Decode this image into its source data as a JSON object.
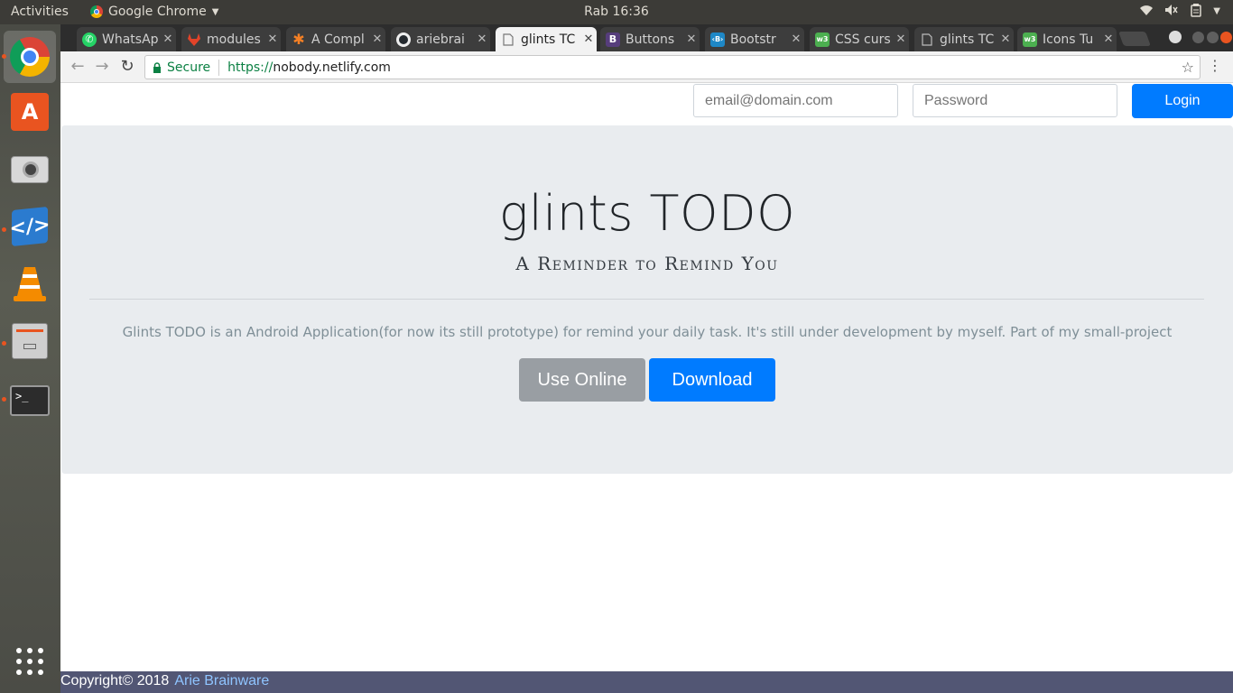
{
  "topbar": {
    "activities": "Activities",
    "app_name": "Google Chrome",
    "clock": "Rab 16:36"
  },
  "dock": {
    "items": [
      "chrome-icon",
      "software-center-icon",
      "camera-icon",
      "vscode-icon",
      "vlc-icon",
      "file-manager-icon",
      "terminal-icon",
      "show-apps-icon"
    ]
  },
  "tabs": [
    {
      "title": "WhatsAp",
      "icon": "whatsapp-icon",
      "color": "#25d366"
    },
    {
      "title": "modules",
      "icon": "gitlab-icon",
      "color": "#e24329"
    },
    {
      "title": "A Compl",
      "icon": "asterisk-icon",
      "color": "#f58025"
    },
    {
      "title": "ariebrai",
      "icon": "github-icon",
      "color": "#24292e"
    },
    {
      "title": "glints TC",
      "icon": "page-icon",
      "color": "#777777"
    },
    {
      "title": "Buttons",
      "icon": "bootstrap-icon",
      "color": "#563d7c"
    },
    {
      "title": "Bootstr",
      "icon": "bootstrap-code-icon",
      "color": "#1e88c7"
    },
    {
      "title": "CSS curs",
      "icon": "w3-icon",
      "color": "#4caf50"
    },
    {
      "title": "glints TC",
      "icon": "page-icon",
      "color": "#777777"
    },
    {
      "title": "Icons Tu",
      "icon": "w3-icon",
      "color": "#4caf50"
    }
  ],
  "omnibox": {
    "secure": "Secure",
    "protocol": "https://",
    "host": "nobody.netlify.com"
  },
  "login": {
    "email_placeholder": "email@domain.com",
    "password_placeholder": "Password",
    "button": "Login"
  },
  "hero": {
    "title": "glints TODO",
    "subtitle": "A Reminder to Remind You",
    "lead": "Glints TODO is an Android Application(for now its still prototype) for remind your daily task. It's still under development by myself. Part of my small-project",
    "use_online": "Use Online",
    "download": "Download"
  },
  "footer": {
    "copyright": "Copyright© 2018",
    "author": "Arie Brainware"
  },
  "colors": {
    "primary": "#007bff",
    "secondary": "#999ea3",
    "jumbotron": "#e9ecef",
    "footer": "#525674"
  }
}
